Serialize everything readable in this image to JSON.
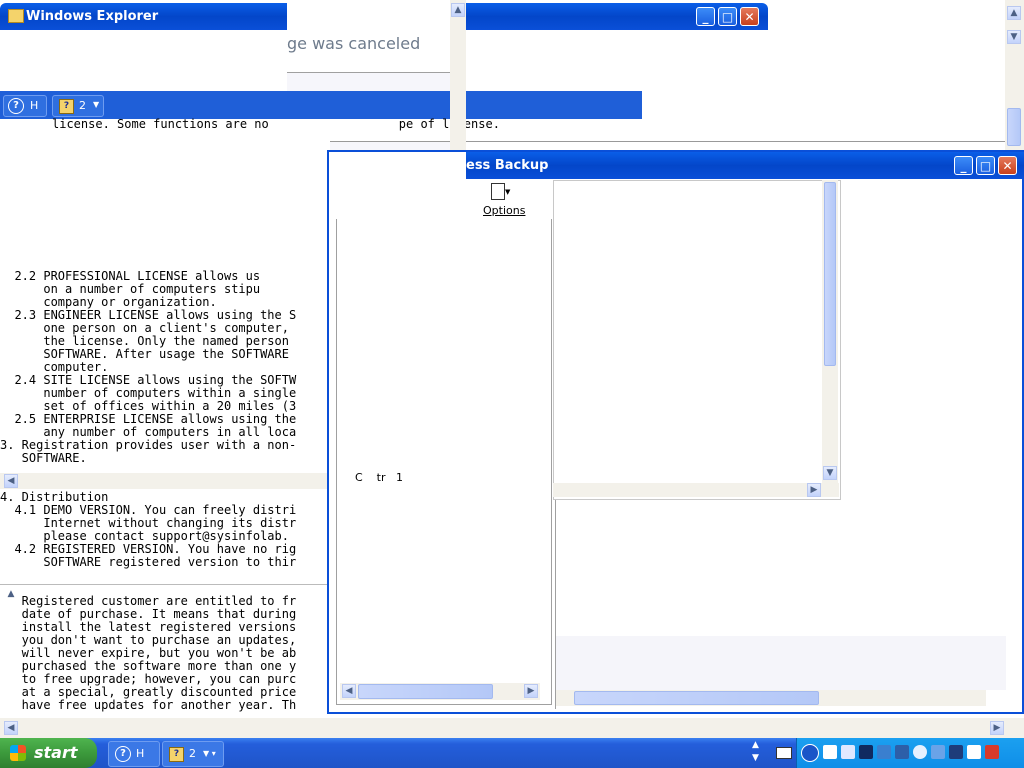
{
  "explorer": {
    "title": "Windows Explorer"
  },
  "dialog": {
    "message": "ge was canceled"
  },
  "help_toolbar": {
    "help_label": "H",
    "badge_label": "2"
  },
  "license": {
    "top_line": "license. Some functions are no                  pe of license.",
    "lines": [
      "  2.2 PROFESSIONAL LICENSE allows us",
      "      on a number of computers stipu",
      "      company or organization.",
      "  2.3 ENGINEER LICENSE allows using the S",
      "      one person on a client's computer,",
      "      the license. Only the named person",
      "      SOFTWARE. After usage the SOFTWARE",
      "      computer.",
      "  2.4 SITE LICENSE allows using the SOFTW",
      "      number of computers within a single",
      "      set of offices within a 20 miles (3",
      "  2.5 ENTERPRISE LICENSE allows using the",
      "      any number of computers in all loca",
      "",
      "3. Registration provides user with a non-",
      "   SOFTWARE.",
      "",
      "4. Distribution",
      "  4.1 DEMO VERSION. You can freely distri",
      "      Internet without changing its distr",
      "      please contact support@sysinfolab.",
      "  4.2 REGISTERED VERSION. You have no rig",
      "      SOFTWARE registered version to thir"
    ],
    "lines2": [
      "   Registered customer are entitled to fr",
      "   date of purchase. It means that during",
      "   install the latest registered versions",
      "   you don't want to purchase an updates,",
      "   will never expire, but you won't be ab",
      "   purchased the software more than one y",
      "   to free upgrade; however, you can purc",
      "   at a special, greatly discounted price",
      "   have free updates for another year. Th"
    ]
  },
  "backup": {
    "title": "ess Backup",
    "options_label": "Options",
    "partial_text": "C    tr   1"
  },
  "taskbar": {
    "start_label": "start",
    "help_label": "H",
    "badge_label": "2"
  },
  "colors": {
    "xp_blue": "#0a4fd8",
    "taskbar_blue": "#245edb",
    "start_green": "#3c9a3c",
    "tray_blue": "#0f8ee8"
  }
}
